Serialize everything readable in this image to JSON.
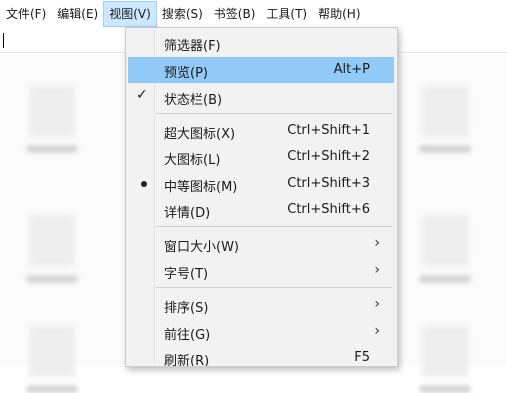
{
  "menubar": {
    "items": [
      {
        "label": "文件(F)"
      },
      {
        "label": "编辑(E)"
      },
      {
        "label": "视图(V)"
      },
      {
        "label": "搜索(S)"
      },
      {
        "label": "书签(B)"
      },
      {
        "label": "工具(T)"
      },
      {
        "label": "帮助(H)"
      }
    ]
  },
  "view_menu": {
    "filter": {
      "label": "筛选器(F)"
    },
    "preview": {
      "label": "预览(P)",
      "accel": "Alt+P"
    },
    "statusbar": {
      "label": "状态栏(B)",
      "checked": true
    },
    "xl_icons": {
      "label": "超大图标(X)",
      "accel": "Ctrl+Shift+1"
    },
    "large_icons": {
      "label": "大图标(L)",
      "accel": "Ctrl+Shift+2"
    },
    "medium_icons": {
      "label": "中等图标(M)",
      "accel": "Ctrl+Shift+3",
      "selected": true
    },
    "details": {
      "label": "详情(D)",
      "accel": "Ctrl+Shift+6"
    },
    "window_size": {
      "label": "窗口大小(W)"
    },
    "font_size": {
      "label": "字号(T)"
    },
    "sort": {
      "label": "排序(S)"
    },
    "goto": {
      "label": "前往(G)"
    },
    "refresh": {
      "label": "刷新(R)",
      "accel": "F5"
    }
  },
  "icons": {
    "check": "checkmark-icon",
    "bullet": "radio-bullet-icon",
    "submenu": "chevron-right-icon"
  },
  "colors": {
    "highlight": "#91c9f7",
    "menubar_active": "#cce8ff"
  }
}
